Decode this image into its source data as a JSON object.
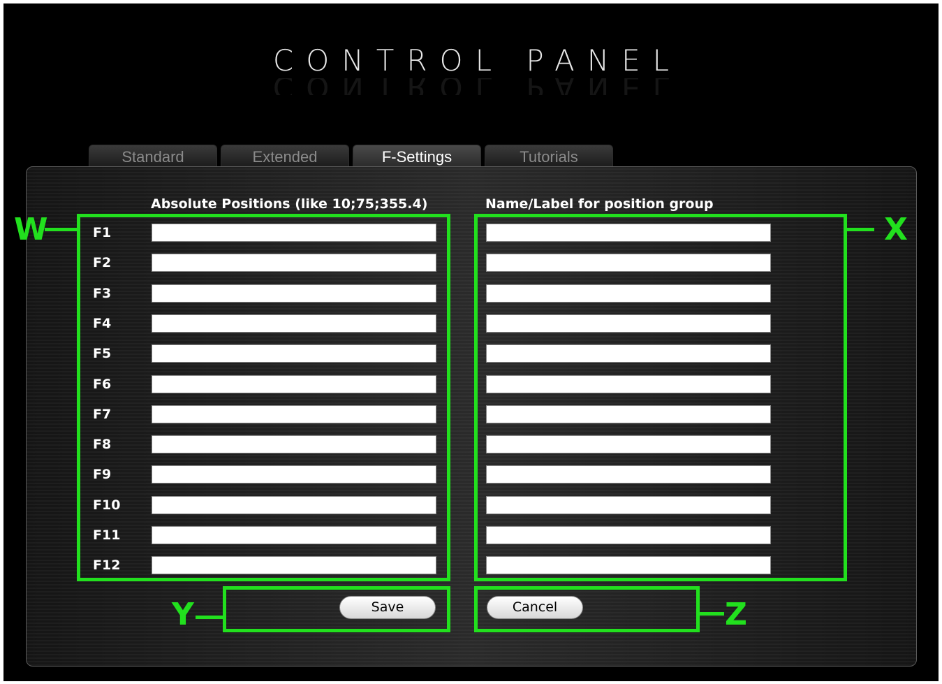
{
  "app": {
    "title": "CONTROL PANEL"
  },
  "tabs": [
    {
      "label": "Standard",
      "active": false
    },
    {
      "label": "Extended",
      "active": false
    },
    {
      "label": "F-Settings",
      "active": true
    },
    {
      "label": "Tutorials",
      "active": false
    }
  ],
  "columns": {
    "positions_header": "Absolute Positions (like 10;75;355.4)",
    "name_header": "Name/Label for position group"
  },
  "rows": [
    {
      "label": "F1",
      "position": "",
      "name": ""
    },
    {
      "label": "F2",
      "position": "",
      "name": ""
    },
    {
      "label": "F3",
      "position": "",
      "name": ""
    },
    {
      "label": "F4",
      "position": "",
      "name": ""
    },
    {
      "label": "F5",
      "position": "",
      "name": ""
    },
    {
      "label": "F6",
      "position": "",
      "name": ""
    },
    {
      "label": "F7",
      "position": "",
      "name": ""
    },
    {
      "label": "F8",
      "position": "",
      "name": ""
    },
    {
      "label": "F9",
      "position": "",
      "name": ""
    },
    {
      "label": "F10",
      "position": "",
      "name": ""
    },
    {
      "label": "F11",
      "position": "",
      "name": ""
    },
    {
      "label": "F12",
      "position": "",
      "name": ""
    }
  ],
  "buttons": {
    "save_label": "Save",
    "cancel_label": "Cancel"
  },
  "annotations": {
    "w": "W",
    "x": "X",
    "y": "Y",
    "z": "Z",
    "color": "#22e01e"
  }
}
